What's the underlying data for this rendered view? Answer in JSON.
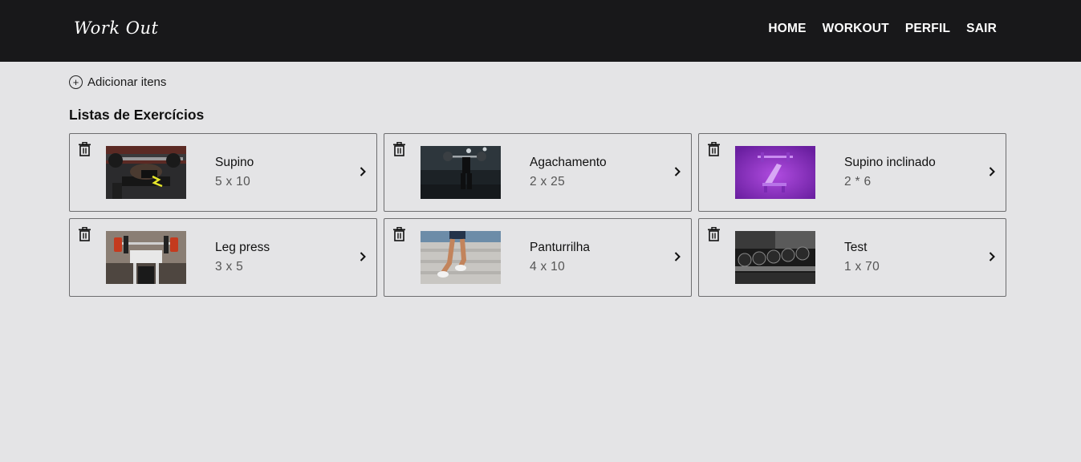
{
  "nav": {
    "logo": "Work Out",
    "links": [
      "HOME",
      "WORKOUT",
      "PERFIL",
      "SAIR"
    ]
  },
  "actions": {
    "add_label": "Adicionar itens"
  },
  "section": {
    "title": "Listas de Exercícios"
  },
  "exercises": [
    {
      "name": "Supino",
      "sets": "5 x 10",
      "image": "bench-press-photo"
    },
    {
      "name": "Agachamento",
      "sets": "2 x 25",
      "image": "squat-photo"
    },
    {
      "name": "Supino inclinado",
      "sets": "2 * 6",
      "image": "incline-bench-photo"
    },
    {
      "name": "Leg press",
      "sets": "3 x 5",
      "image": "leg-press-photo"
    },
    {
      "name": "Panturrilha",
      "sets": "4 x 10",
      "image": "calf-raise-photo"
    },
    {
      "name": "Test",
      "sets": "1 x 70",
      "image": "dumbbell-rack-photo"
    }
  ],
  "icons": {
    "delete": "trash-icon",
    "open": "chevron-right-icon",
    "add": "plus-circle-icon"
  },
  "colors": {
    "navbar": "#18181a",
    "background": "#e4e4e6",
    "card_border": "#6d6d6f"
  }
}
